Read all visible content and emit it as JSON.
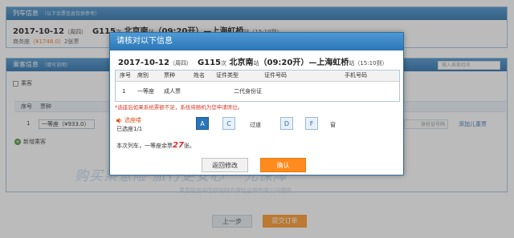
{
  "panel1": {
    "title": "列车信息",
    "subtitle": "（以下余票信息仅供参考）",
    "trip": {
      "date": "2017-10-12",
      "weekday": "（周四）",
      "train": "G115",
      "train_suffix": "次",
      "from": "北京南",
      "from_suffix": "站",
      "depart": "（09:20开）",
      "arrow": "—",
      "to": "上海虹桥",
      "to_suffix": "站",
      "arrive": "（15:10到）"
    },
    "price_prefix": "商务座",
    "price_value": "（¥1748.0）",
    "price_count": "2张票"
  },
  "panel2": {
    "title": "乘客信息",
    "subtitle": "（填写说明）",
    "search_placeholder": "输入乘客姓名",
    "passenger_label": "乘客",
    "passenger_col": "序号",
    "passenger_col2": "票种",
    "row_index": "1",
    "seat_select": "一等座（¥933.0）",
    "id_placeholder": "身份证号码",
    "row_link": "添加儿童票",
    "add_passenger": "新增乘客",
    "banner": "购买乘意险 旅行更安心 一元保障",
    "banner_sub": "乘意险由中国铁路财产保险自保有限公司提供"
  },
  "bottom": {
    "prev": "上一步",
    "submit": "提交订单"
  },
  "modal": {
    "title": "请核对以下信息",
    "trip": {
      "date": "2017-10-12",
      "weekday": "（周四）",
      "train": "G115",
      "train_suffix": "次",
      "from": "北京南",
      "from_suffix": "站",
      "depart": "（09:20开）",
      "arrow": "—",
      "to": "上海虹桥",
      "to_suffix": "站",
      "arrive": "（15:10到）"
    },
    "columns": [
      "序号",
      "席别",
      "票种",
      "姓名",
      "证件类型",
      "证件号码",
      "手机号码"
    ],
    "row": {
      "index": "1",
      "seat": "一等座",
      "ticket": "成人票",
      "name": "",
      "id_type": "二代身份证",
      "id_no": "",
      "phone": ""
    },
    "notice": "*选座后如果系统票额不足，系统将随机为您申请席位。",
    "seat_select_label": "选座喽",
    "seat_selected": "已选座1/1",
    "window_left": "窗",
    "aisle": "过道",
    "window_right": "窗",
    "seats": [
      "A",
      "C",
      "D",
      "F"
    ],
    "selected_seat": "A",
    "remain_prefix": "本次列车，一等座余票",
    "remain_count": "27",
    "remain_suffix": "张。",
    "back_button": "返回修改",
    "confirm_button": "确认"
  }
}
